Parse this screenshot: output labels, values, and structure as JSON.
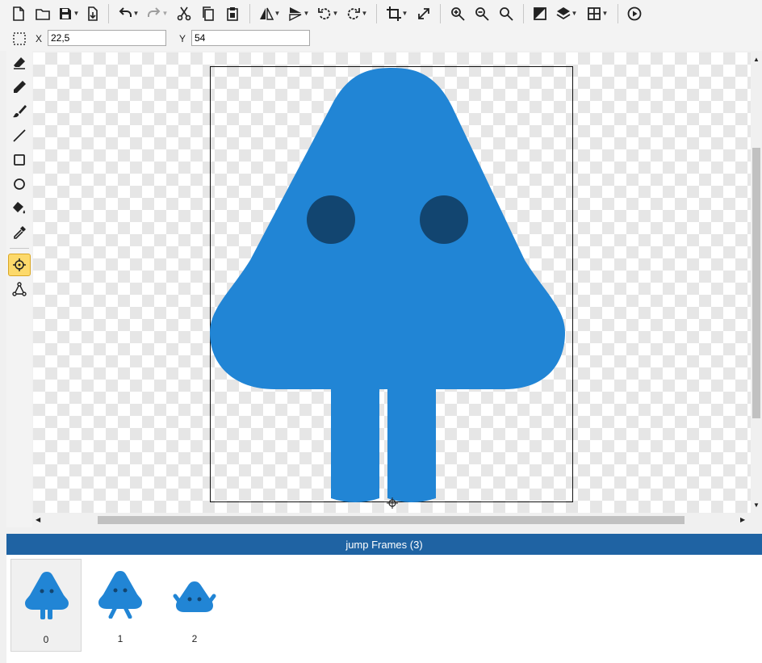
{
  "toolbar": {
    "icons": [
      "new-file-icon",
      "open-folder-icon",
      "save-icon",
      "export-icon",
      "undo-icon",
      "redo-icon",
      "cut-icon",
      "copy-icon",
      "paste-icon",
      "flip-horizontal-icon",
      "flip-vertical-icon",
      "rotate-left-icon",
      "rotate-right-icon",
      "crop-icon",
      "resize-icon",
      "zoom-in-icon",
      "zoom-out-icon",
      "zoom-reset-icon",
      "color-mode-icon",
      "layers-icon",
      "grid-icon",
      "play-icon"
    ]
  },
  "coords": {
    "x_label": "X",
    "x_value": "22,5",
    "y_label": "Y",
    "y_value": "54"
  },
  "tools": [
    "eraser-icon",
    "pencil-icon",
    "brush-icon",
    "line-icon",
    "rectangle-icon",
    "ellipse-icon",
    "fill-bucket-icon",
    "eyedropper-icon",
    "pivot-icon",
    "bones-icon"
  ],
  "active_tool": "pivot-icon",
  "colors": {
    "body": "#2185d5",
    "eyes": "#124570",
    "accent": "#1f63a3"
  },
  "frames_panel": {
    "title": "jump Frames (3)",
    "frames": [
      {
        "label": "0"
      },
      {
        "label": "1"
      },
      {
        "label": "2"
      }
    ],
    "selected": "0"
  }
}
